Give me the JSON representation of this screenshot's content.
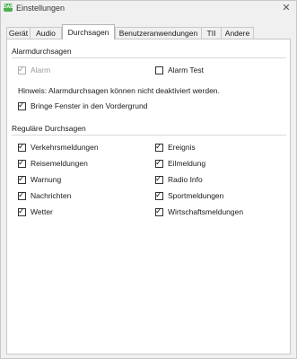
{
  "window": {
    "title": "Einstellungen",
    "app_icon_text": "DAB",
    "close_glyph": "✕"
  },
  "tabs": [
    {
      "label": "Gerät"
    },
    {
      "label": "Audio"
    },
    {
      "label": "Durchsagen"
    },
    {
      "label": "Benutzeranwendungen"
    },
    {
      "label": "TII"
    },
    {
      "label": "Andere"
    }
  ],
  "active_tab": "Durchsagen",
  "alarm_section": {
    "title": "Alarmdurchsagen",
    "alarm": {
      "label": "Alarm",
      "checked": true,
      "disabled": true
    },
    "alarm_test": {
      "label": "Alarm Test",
      "checked": false
    },
    "hint": "Hinweis: Alarmdurchsagen können nicht deaktiviert werden.",
    "foreground": {
      "label": "Bringe Fenster in den Vordergrund",
      "checked": true
    }
  },
  "regular_section": {
    "title": "Reguläre Durchsagen",
    "left": [
      {
        "label": "Verkehrsmeldungen",
        "checked": true
      },
      {
        "label": "Reisemeldungen",
        "checked": true
      },
      {
        "label": "Warnung",
        "checked": true
      },
      {
        "label": "Nachrichten",
        "checked": true
      },
      {
        "label": "Wetter",
        "checked": true
      }
    ],
    "right": [
      {
        "label": "Ereignis",
        "checked": true
      },
      {
        "label": "Eilmeldung",
        "checked": true
      },
      {
        "label": "Radio Info",
        "checked": true
      },
      {
        "label": "Sportmeldungen",
        "checked": true
      },
      {
        "label": "Wirtschaftsmeldungen",
        "checked": true
      }
    ]
  },
  "check_glyph": "✓"
}
